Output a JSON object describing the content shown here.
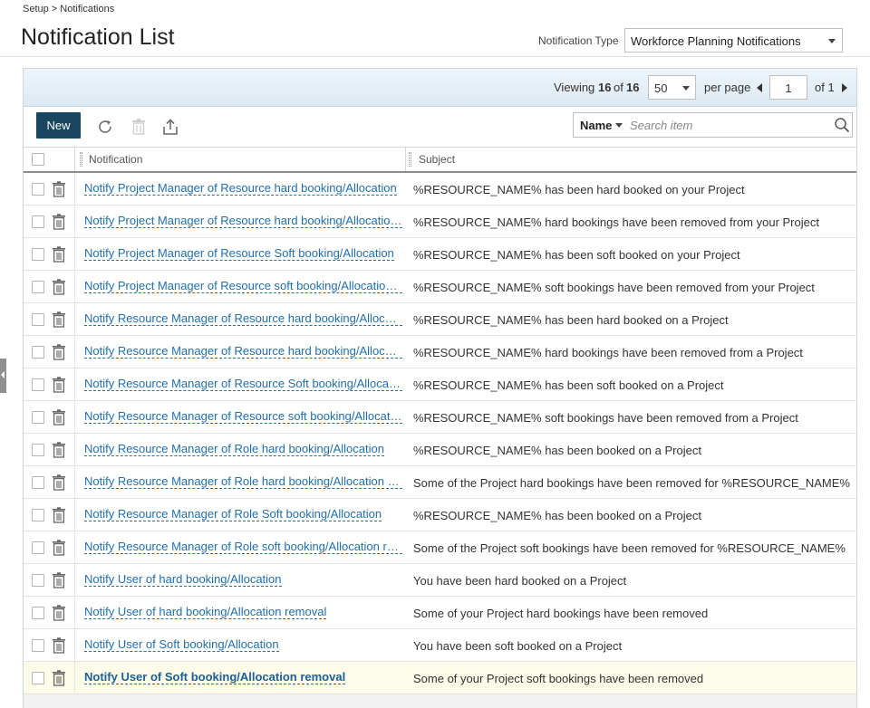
{
  "breadcrumb": {
    "text": "Setup > Notifications"
  },
  "page": {
    "title": "Notification List"
  },
  "notification_type": {
    "label": "Notification Type",
    "value": "Workforce Planning Notifications"
  },
  "pager": {
    "viewing_label": "Viewing",
    "viewing_count": "16",
    "of_label": "of",
    "total": "16",
    "per_page_value": "50",
    "per_page_label": "per page",
    "current_page": "1",
    "of_pages": "of 1"
  },
  "toolbar": {
    "new_label": "New",
    "search_field": "Name",
    "search_placeholder": "Search item"
  },
  "columns": {
    "notification": "Notification",
    "subject": "Subject"
  },
  "rows": [
    {
      "name": "Notify Project Manager of Resource hard booking/Allocation",
      "subject": "%RESOURCE_NAME% has been hard booked on your Project"
    },
    {
      "name": "Notify Project Manager of Resource hard booking/Allocation removal",
      "subject": "%RESOURCE_NAME% hard bookings have been removed from your Project"
    },
    {
      "name": "Notify Project Manager of Resource Soft booking/Allocation",
      "subject": "%RESOURCE_NAME% has been soft booked on your Project"
    },
    {
      "name": "Notify Project Manager of Resource soft booking/Allocation removal",
      "subject": "%RESOURCE_NAME% soft bookings have been removed from your Project"
    },
    {
      "name": "Notify Resource Manager of Resource hard booking/Allocation",
      "subject": "%RESOURCE_NAME% has been hard booked on a Project"
    },
    {
      "name": "Notify Resource Manager of Resource hard booking/Allocation removal",
      "subject": "%RESOURCE_NAME% hard bookings have been removed from a Project"
    },
    {
      "name": "Notify Resource Manager of Resource Soft booking/Allocation",
      "subject": "%RESOURCE_NAME% has been soft booked on a Project"
    },
    {
      "name": "Notify Resource Manager of Resource soft booking/Allocation removal",
      "subject": "%RESOURCE_NAME% soft bookings have been removed from a Project"
    },
    {
      "name": "Notify Resource Manager of Role hard booking/Allocation",
      "subject": "%RESOURCE_NAME% has been booked on a Project"
    },
    {
      "name": "Notify Resource Manager of Role hard booking/Allocation removal",
      "subject": "Some of the Project hard bookings have been removed for %RESOURCE_NAME%"
    },
    {
      "name": "Notify Resource Manager of Role Soft booking/Allocation",
      "subject": "%RESOURCE_NAME% has been booked on a Project"
    },
    {
      "name": "Notify Resource Manager of Role soft booking/Allocation removal",
      "subject": "Some of the Project soft bookings have been removed for %RESOURCE_NAME%"
    },
    {
      "name": "Notify User of hard booking/Allocation",
      "subject": "You have been hard booked on a Project"
    },
    {
      "name": "Notify User of hard booking/Allocation removal",
      "subject": "Some of your Project hard bookings have been removed"
    },
    {
      "name": "Notify User of Soft booking/Allocation",
      "subject": "You have been soft booked on a Project"
    },
    {
      "name": "Notify User of Soft booking/Allocation removal",
      "subject": "Some of your Project soft bookings have been removed",
      "selected": true
    }
  ],
  "colors": {
    "primary_button": "#18465f",
    "link": "#1f6fb2",
    "selected_row": "#fcfce8",
    "pager_bg": "#e6eff7"
  },
  "icons": [
    "refresh-icon",
    "trash-icon",
    "export-icon",
    "search-icon",
    "chevron-down-icon",
    "prev-page-icon",
    "next-page-icon",
    "collapse-panel-icon"
  ]
}
